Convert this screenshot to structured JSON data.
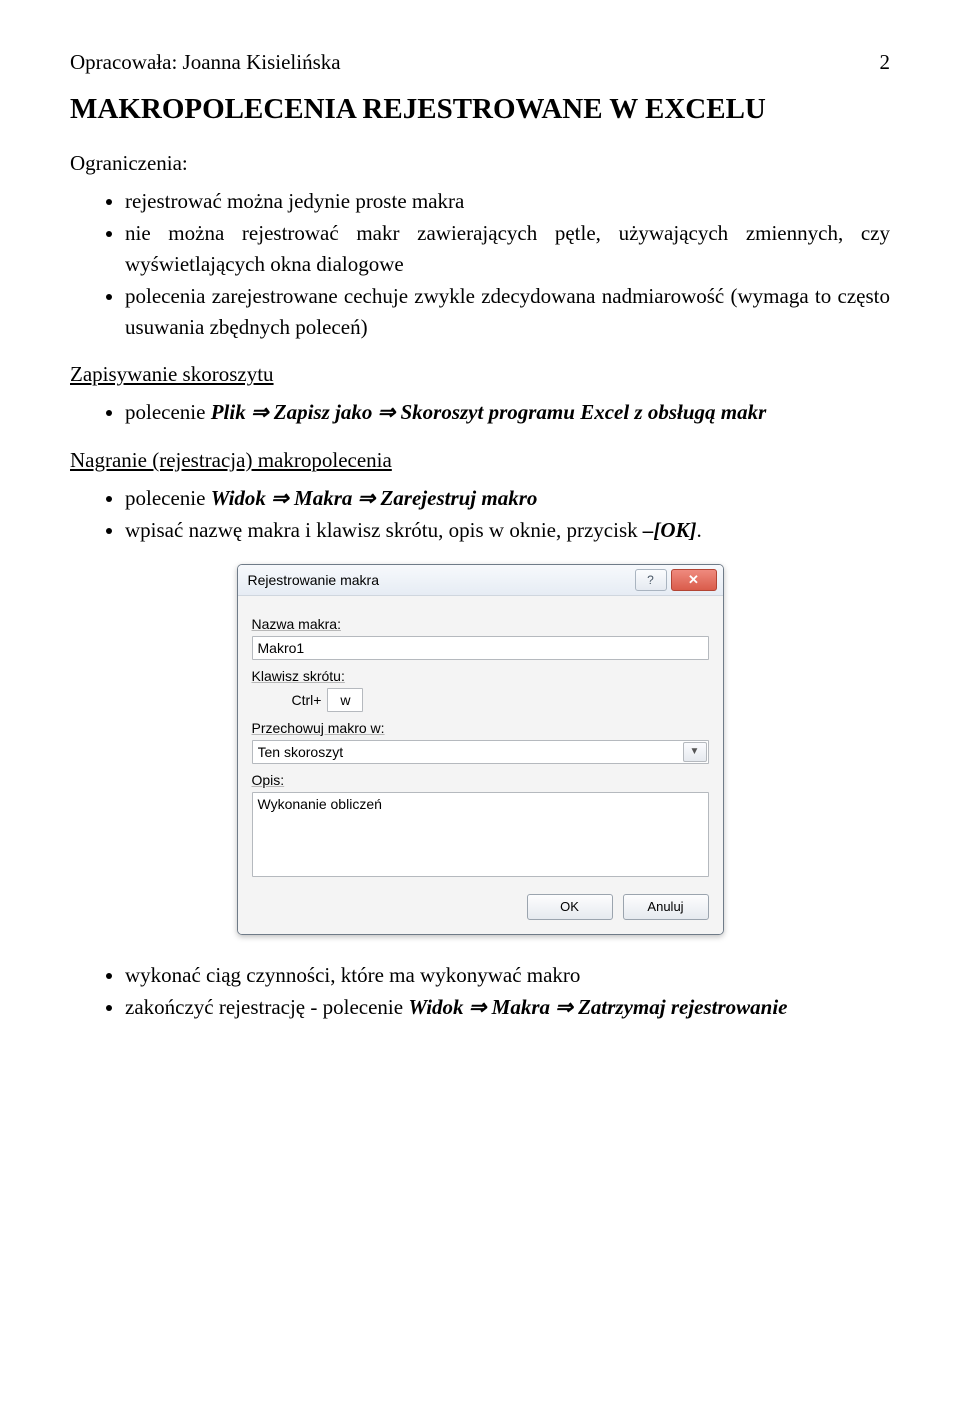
{
  "header": {
    "author_prefix": "Opracowała: Joanna Kisielińska",
    "page_number": "2"
  },
  "title": "MAKROPOLECENIA REJESTROWANE W EXCELU",
  "sec_limits": {
    "heading": "Ograniczenia:",
    "items": [
      "rejestrować można jedynie proste makra",
      "nie można rejestrować makr zawierających pętle, używających zmiennych, czy wyświetlających okna dialogowe",
      "polecenia zarejestrowane cechuje zwykle zdecydowana nadmiarowość (wymaga to często usuwania zbędnych poleceń)"
    ]
  },
  "sec_save": {
    "heading": "Zapisywanie skoroszytu",
    "item_pre": "polecenie ",
    "item_bold1": "Plik ⇒ Zapisz jako ⇒ Skoroszyt programu Excel z obsługą makr"
  },
  "sec_record": {
    "heading": "Nagranie (rejestracja) makropolecenia",
    "b1_pre": "polecenie ",
    "b1_bold": "Widok ⇒ Makra ⇒ Zarejestruj makro",
    "b2_pre": "wpisać nazwę makra i klawisz skrótu, opis w oknie, przycisk ",
    "b2_bold": "–[OK]",
    "b2_post": "."
  },
  "dialog": {
    "title": "Rejestrowanie makra",
    "labels": {
      "name": "Nazwa makra:",
      "shortcut": "Klawisz skrótu:",
      "ctrl": "Ctrl+",
      "store": "Przechowuj makro w:",
      "desc": "Opis:"
    },
    "values": {
      "name": "Makro1",
      "shortkey": "w",
      "store": "Ten skoroszyt",
      "desc": "Wykonanie obliczeń"
    },
    "buttons": {
      "ok": "OK",
      "cancel": "Anuluj"
    }
  },
  "sec_after": {
    "b1": "wykonać ciąg czynności, które ma wykonywać makro",
    "b2_pre": "zakończyć rejestrację - polecenie ",
    "b2_bold": "Widok ⇒ Makra ⇒ Zatrzymaj rejestrowanie"
  }
}
